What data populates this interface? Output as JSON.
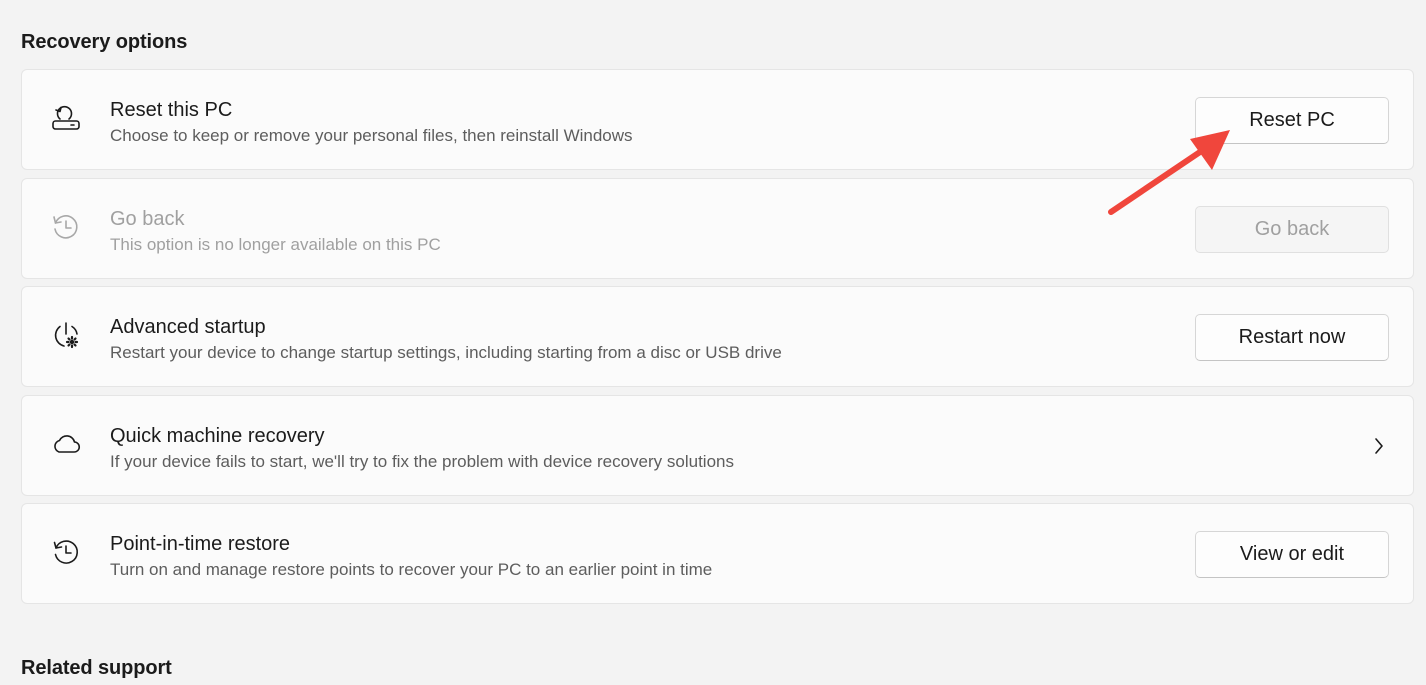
{
  "sections": {
    "recovery_title": "Recovery options",
    "support_title": "Related support"
  },
  "options": [
    {
      "title": "Reset this PC",
      "description": "Choose to keep or remove your personal files, then reinstall Windows",
      "action_label": "Reset PC",
      "icon": "reset-pc-icon",
      "enabled": true
    },
    {
      "title": "Go back",
      "description": "This option is no longer available on this PC",
      "action_label": "Go back",
      "icon": "history-icon",
      "enabled": false
    },
    {
      "title": "Advanced startup",
      "description": "Restart your device to change startup settings, including starting from a disc or USB drive",
      "action_label": "Restart now",
      "icon": "power-settings-icon",
      "enabled": true
    },
    {
      "title": "Quick machine recovery",
      "description": "If your device fails to start, we'll try to fix the problem with device recovery solutions",
      "icon": "cloud-icon",
      "chevron_icon": "chevron-right-icon",
      "enabled": true
    },
    {
      "title": "Point-in-time restore",
      "description": "Turn on and manage restore points to recover your PC to an earlier point in time",
      "action_label": "View or edit",
      "icon": "restore-history-icon",
      "enabled": true
    }
  ],
  "annotation": {
    "arrow_color": "#f0463c",
    "target": "Reset PC"
  },
  "colors": {
    "background": "#f3f3f3",
    "card": "#fbfbfb",
    "text_primary": "#1b1b1b",
    "text_secondary": "#5d5d5d",
    "text_disabled": "#a0a0a0"
  }
}
